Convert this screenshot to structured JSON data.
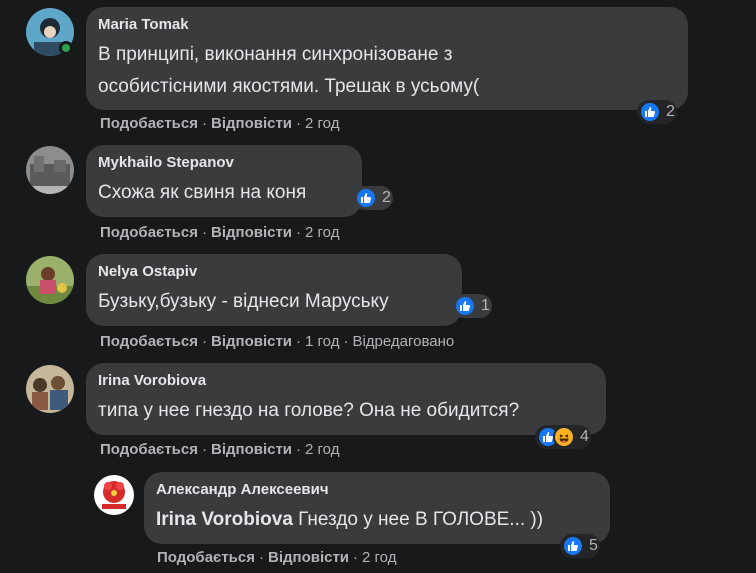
{
  "comments": [
    {
      "author": "Maria Tomak",
      "text_line1": "В принципі, виконання синхронізоване з",
      "text_line2": "особистісними якостями. Трешак в усьому(",
      "reaction_count": "2",
      "like_label": "Подобається",
      "reply_label": "Відповісти",
      "time": "2 год"
    },
    {
      "author": "Mykhailo Stepanov",
      "text": "Схожа як свиня на коня",
      "reaction_count": "2",
      "like_label": "Подобається",
      "reply_label": "Відповісти",
      "time": "2 год"
    },
    {
      "author": "Nelya Ostapiv",
      "text": "Бузьку,бузьку - віднеси Маруську",
      "reaction_count": "1",
      "like_label": "Подобається",
      "reply_label": "Відповісти",
      "time": "1 год",
      "edited": "Відредаговано"
    },
    {
      "author": "Irina Vorobiova",
      "text": "типа у нее гнездо на голове? Она не обидится?",
      "reaction_count": "4",
      "like_label": "Подобається",
      "reply_label": "Відповісти",
      "time": "2 год"
    },
    {
      "author": "Александр Алексеевич",
      "mention": "Irina Vorobiova",
      "text": " Гнездо у нее В ГОЛОВЕ... ))",
      "reaction_count": "5",
      "like_label": "Подобається",
      "reply_label": "Відповісти",
      "time": "2 год"
    }
  ],
  "colors": {
    "background": "#18191a",
    "bubble": "#3a3b3c",
    "like_blue": "#1877f2",
    "haha_yellow": "#f7b125",
    "online_green": "#31a24c"
  },
  "icons": [
    "like-icon",
    "haha-icon"
  ]
}
